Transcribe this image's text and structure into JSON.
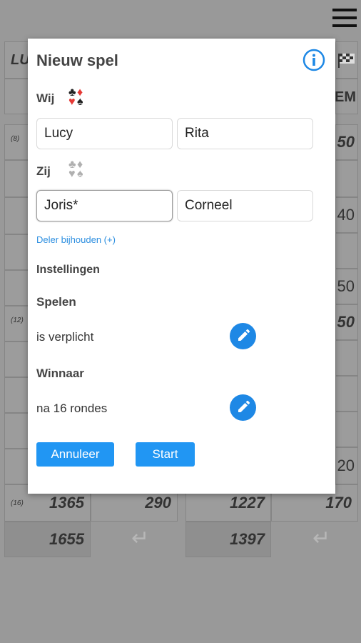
{
  "background": {
    "header_left": "LU",
    "header_right": "EM",
    "rows": [
      {
        "index": "(8)",
        "right": "50"
      },
      {
        "index": "",
        "right": "40"
      },
      {
        "index": "",
        "right": "50"
      },
      {
        "index": "(12)",
        "right": "50"
      },
      {
        "index": "",
        "right": "20"
      }
    ],
    "row16": {
      "index": "(16)",
      "total_left": "1365",
      "diff_left": "290",
      "total_right": "1227",
      "diff_right": "170"
    },
    "final": {
      "left": "1655",
      "right": "1397",
      "enter_symbol": "↵"
    }
  },
  "dialog": {
    "title": "Nieuw spel",
    "team_wij_label": "Wij",
    "team_zij_label": "Zij",
    "wij_players": [
      "Lucy",
      "Rita"
    ],
    "zij_players": [
      "Joris*",
      "Corneel"
    ],
    "dealer_link": "Deler bijhouden  (+)",
    "settings_label": "Instellingen",
    "spelen_label": "Spelen",
    "spelen_value": "is verplicht",
    "winnaar_label": "Winnaar",
    "winnaar_value": "na 16 rondes",
    "cancel_label": "Annuleer",
    "start_label": "Start"
  },
  "colors": {
    "accent": "#2196f3",
    "edit_button": "#1e88e5",
    "link": "#2d8fe0",
    "suit_red": "#e53935",
    "suit_black": "#222222",
    "suit_grey": "#b0b0b0"
  },
  "icons": [
    "menu-icon",
    "info-icon",
    "checkered-flag-icon",
    "card-suits-icon",
    "pencil-icon",
    "enter-icon"
  ]
}
